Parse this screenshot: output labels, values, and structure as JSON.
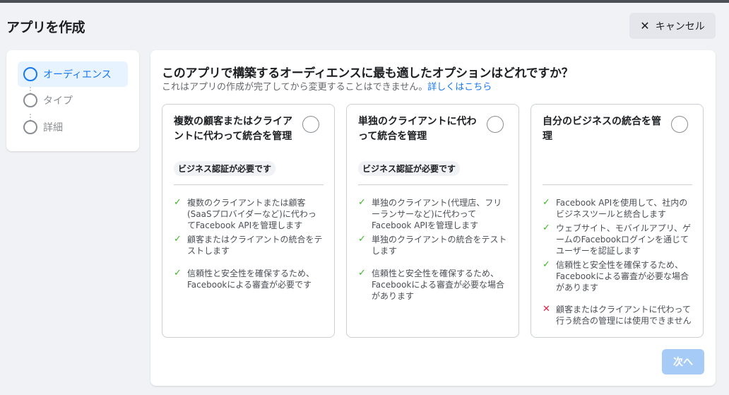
{
  "header": {
    "title": "アプリを作成",
    "cancel_label": "キャンセル"
  },
  "stepper": {
    "steps": [
      {
        "label": "オーディエンス"
      },
      {
        "label": "タイプ"
      },
      {
        "label": "詳細"
      }
    ]
  },
  "main": {
    "question": "このアプリで構築するオーディエンスに最も適したオプションはどれですか？",
    "subtitle": "これはアプリの作成が完了してから変更することはできません。",
    "learn_more": "詳しくはこちら",
    "next_label": "次へ"
  },
  "cards": [
    {
      "title": "複数の顧客またはクライアントに代わって統合を管理",
      "badge": "ビジネス認証が必要です",
      "bullets": [
        {
          "icon": "check",
          "text": "複数のクライアントまたは顧客(SaaSプロバイダーなど)に代わってFacebook APIを管理します"
        },
        {
          "icon": "check",
          "text": "顧客またはクライアントの統合をテストします"
        },
        {
          "icon": "check",
          "text": "信頼性と安全性を確保するため、Facebookによる審査が必要です"
        }
      ]
    },
    {
      "title": "単独のクライアントに代わって統合を管理",
      "badge": "ビジネス認証が必要です",
      "bullets": [
        {
          "icon": "check",
          "text": "単独のクライアント(代理店、フリーランサーなど)に代わってFacebook APIを管理します"
        },
        {
          "icon": "check",
          "text": "単独のクライアントの統合をテストします"
        },
        {
          "icon": "check",
          "text": "信頼性と安全性を確保するため、Facebookによる審査が必要な場合があります"
        }
      ]
    },
    {
      "title": "自分のビジネスの統合を管理",
      "badge": "",
      "bullets": [
        {
          "icon": "check",
          "text": "Facebook APIを使用して、社内のビジネスツールと統合します"
        },
        {
          "icon": "check",
          "text": "ウェブサイト、モバイルアプリ、ゲームのFacebookログインを通じてユーザーを認証します"
        },
        {
          "icon": "check",
          "text": "信頼性と安全性を確保するため、Facebookによる審査が必要な場合があります"
        },
        {
          "icon": "cross",
          "text": "顧客またはクライアントに代わって行う統合の管理には使用できません"
        }
      ]
    }
  ],
  "colors": {
    "accent": "#1877f2",
    "check": "#42b72a",
    "cross": "#e41e3f",
    "disabled_button": "#a7cbf7"
  }
}
